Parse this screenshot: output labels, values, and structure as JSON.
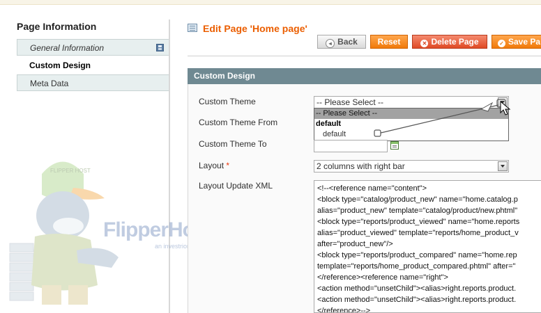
{
  "sidebar": {
    "title": "Page Information",
    "tabs": [
      {
        "label": "General Information",
        "icon": "floppy-disk-icon"
      },
      {
        "label": "Custom Design"
      },
      {
        "label": "Meta Data"
      }
    ]
  },
  "watermark": {
    "brand": "FlipperHost",
    "tagline": "an investrion company",
    "cap_text": "FLIPPER HOST"
  },
  "header": {
    "title": "Edit Page 'Home page'",
    "buttons": {
      "back": "Back",
      "reset": "Reset",
      "delete": "Delete Page",
      "save": "Save Pa"
    }
  },
  "section": {
    "title": "Custom Design",
    "fields": {
      "custom_theme": {
        "label": "Custom Theme",
        "value": "-- Please Select --"
      },
      "custom_theme_from": {
        "label": "Custom Theme From"
      },
      "custom_theme_to": {
        "label": "Custom Theme To"
      },
      "layout": {
        "label": "Layout",
        "required_mark": "*",
        "value": "2 columns with right bar"
      },
      "layout_update_xml": {
        "label": "Layout Update XML",
        "lines": [
          "<!--<reference name=\"content\">",
          "<block type=\"catalog/product_new\" name=\"home.catalog.p",
          "alias=\"product_new\" template=\"catalog/product/new.phtml\"",
          "<block type=\"reports/product_viewed\" name=\"home.reports",
          "alias=\"product_viewed\" template=\"reports/home_product_v",
          "after=\"product_new\"/>",
          "<block type=\"reports/product_compared\" name=\"home.rep",
          "template=\"reports/home_product_compared.phtml\" after=\"",
          "</reference><reference name=\"right\">",
          "<action method=\"unsetChild\"><alias>right.reports.product.",
          "<action method=\"unsetChild\"><alias>right.reports.product.",
          "</reference>-->"
        ]
      }
    },
    "dropdown_options": [
      {
        "label": "-- Please Select --",
        "highlighted": true
      },
      {
        "label": "default",
        "group": true
      },
      {
        "label": "default",
        "child": true
      }
    ]
  },
  "colors": {
    "accent": "#eb5e00",
    "section_header": "#6f8992",
    "danger": "#df4a25"
  }
}
